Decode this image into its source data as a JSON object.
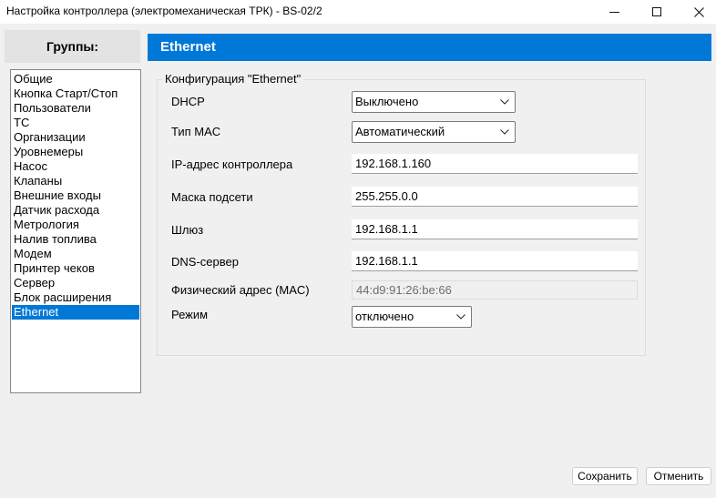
{
  "window": {
    "title": "Настройка контроллера (электромеханическая ТРК) - BS-02/2",
    "controls": {
      "minimize": "minimize-icon",
      "maximize": "maximize-icon",
      "close": "close-icon"
    }
  },
  "groups": {
    "header": "Группы:",
    "items": [
      "Общие",
      "Кнопка Старт/Стоп",
      "Пользователи",
      "ТС",
      "Организации",
      "Уровнемеры",
      "Насос",
      "Клапаны",
      "Внешние входы",
      "Датчик расхода",
      "Метрология",
      "Налив топлива",
      "Модем",
      "Принтер чеков",
      "Сервер",
      "Блок расширения",
      "Ethernet"
    ],
    "selected": "Ethernet"
  },
  "section": {
    "title": "Ethernet",
    "groupbox_label": "Конфигурация \"Ethernet\"",
    "fields": {
      "dhcp": {
        "label": "DHCP",
        "value": "Выключено"
      },
      "mac_type": {
        "label": "Тип MAC",
        "value": "Автоматический"
      },
      "ip": {
        "label": "IP-адрес контроллера",
        "value": "192.168.1.160"
      },
      "mask": {
        "label": "Маска подсети",
        "value": "255.255.0.0"
      },
      "gateway": {
        "label": "Шлюз",
        "value": "192.168.1.1"
      },
      "dns": {
        "label": "DNS-сервер",
        "value": "192.168.1.1"
      },
      "mac": {
        "label": "Физический адрес (MAC)",
        "value": "44:d9:91:26:be:66"
      },
      "mode": {
        "label": "Режим",
        "value": "отключено"
      }
    }
  },
  "buttons": {
    "save": "Сохранить",
    "cancel": "Отменить"
  },
  "colors": {
    "accent": "#0078d7",
    "window_bg": "#f0f0f0"
  }
}
